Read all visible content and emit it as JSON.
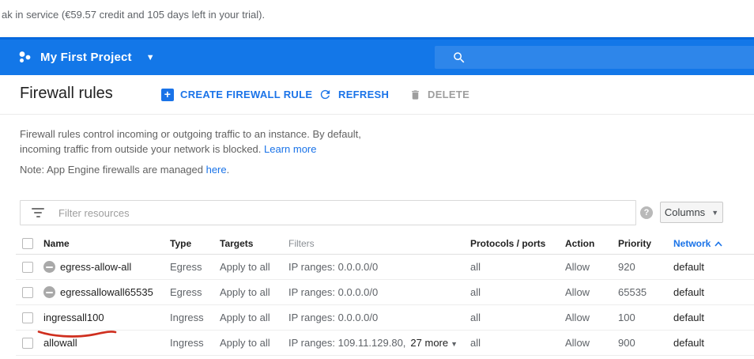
{
  "banner": {
    "trial_text": "ak in service (€59.57 credit and 105 days left in your trial)."
  },
  "header": {
    "project_name": "My First Project"
  },
  "toolbar": {
    "page_title": "Firewall rules",
    "create_button": "CREATE FIREWALL RULE",
    "refresh_button": "REFRESH",
    "delete_button": "DELETE"
  },
  "description": {
    "line1": "Firewall rules control incoming or outgoing traffic to an instance. By default,",
    "line2": "incoming traffic from outside your network is blocked. ",
    "learn_more_link": "Learn more",
    "note_text": "Note: App Engine firewalls are managed ",
    "note_link": "here",
    "note_period": "."
  },
  "filter_bar": {
    "placeholder": "Filter resources",
    "columns_button": "Columns"
  },
  "table": {
    "headers": {
      "name": "Name",
      "type": "Type",
      "targets": "Targets",
      "filters": "Filters",
      "protocols": "Protocols / ports",
      "action": "Action",
      "priority": "Priority",
      "network": "Network"
    },
    "rows": [
      {
        "name": "egress-allow-all",
        "type": "Egress",
        "targets": "Apply to all",
        "filters": "IP ranges: 0.0.0.0/0",
        "protocols": "all",
        "action": "Allow",
        "priority": "920",
        "network": "default",
        "has_direction_icon": true
      },
      {
        "name": "egressallowall65535",
        "type": "Egress",
        "targets": "Apply to all",
        "filters": "IP ranges: 0.0.0.0/0",
        "protocols": "all",
        "action": "Allow",
        "priority": "65535",
        "network": "default",
        "has_direction_icon": true
      },
      {
        "name": "ingressall100",
        "type": "Ingress",
        "targets": "Apply to all",
        "filters": "IP ranges: 0.0.0.0/0",
        "protocols": "all",
        "action": "Allow",
        "priority": "100",
        "network": "default",
        "has_direction_icon": false
      },
      {
        "name": "allowall",
        "type": "Ingress",
        "targets": "Apply to all",
        "filters": "IP ranges: 109.11.129.80,",
        "filters_more": "27 more",
        "protocols": "all",
        "action": "Allow",
        "priority": "900",
        "network": "default",
        "has_direction_icon": false
      }
    ]
  },
  "annotation": {
    "type": "red-underline",
    "target_row": "ingressall100",
    "color": "#cf2e1e"
  },
  "colors": {
    "header_blue": "#1377e8",
    "search_field_blue": "#2e86ea",
    "accent_blue": "#1a73e8",
    "text_dark": "#212121",
    "text_gray": "#5f6368"
  }
}
